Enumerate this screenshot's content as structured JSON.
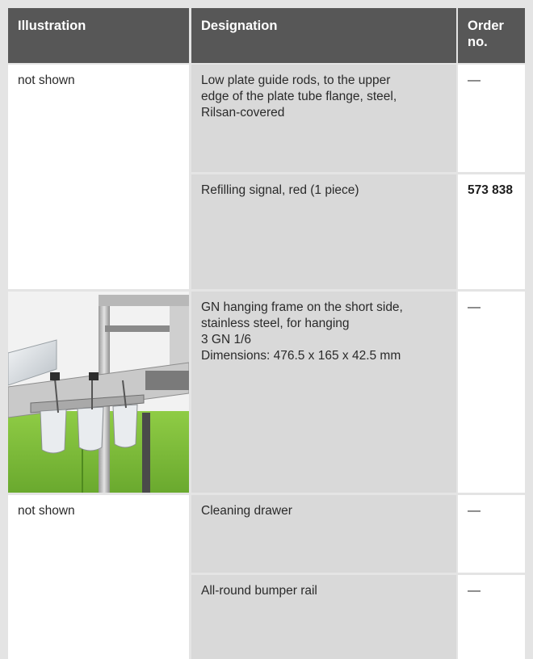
{
  "table": {
    "headers": {
      "illustration": "Illustration",
      "designation": "Designation",
      "order_line1": "Order",
      "order_line2": "no."
    },
    "rows": [
      {
        "illustration": "not shown",
        "designation_lines": [
          "Low plate guide rods, to the upper",
          "edge of the plate tube flange, steel,",
          "Rilsan-covered"
        ],
        "order": "—"
      },
      {
        "illustration": "",
        "designation_lines": [
          "Refilling signal, red (1 piece)"
        ],
        "order": "573 838"
      },
      {
        "illustration": "",
        "designation_lines": [
          "GN hanging frame on the short side,",
          "stainless steel, for hanging",
          "3 GN 1/6",
          "Dimensions: 476.5 x 165 x 42.5 mm"
        ],
        "order": "—"
      },
      {
        "illustration": "not shown",
        "designation_lines": [
          "Cleaning drawer"
        ],
        "order": "—"
      },
      {
        "illustration": "",
        "designation_lines": [
          "All-round bumper rail"
        ],
        "order": "—"
      }
    ]
  },
  "colors": {
    "header_bg": "#575757",
    "cell_grey": "#d9d9d9",
    "cell_white": "#ffffff",
    "page_bg": "#e4e4e4",
    "product_green": "#7cbf3a"
  },
  "photo": {
    "icon": "gn-hanging-frame-photo"
  }
}
